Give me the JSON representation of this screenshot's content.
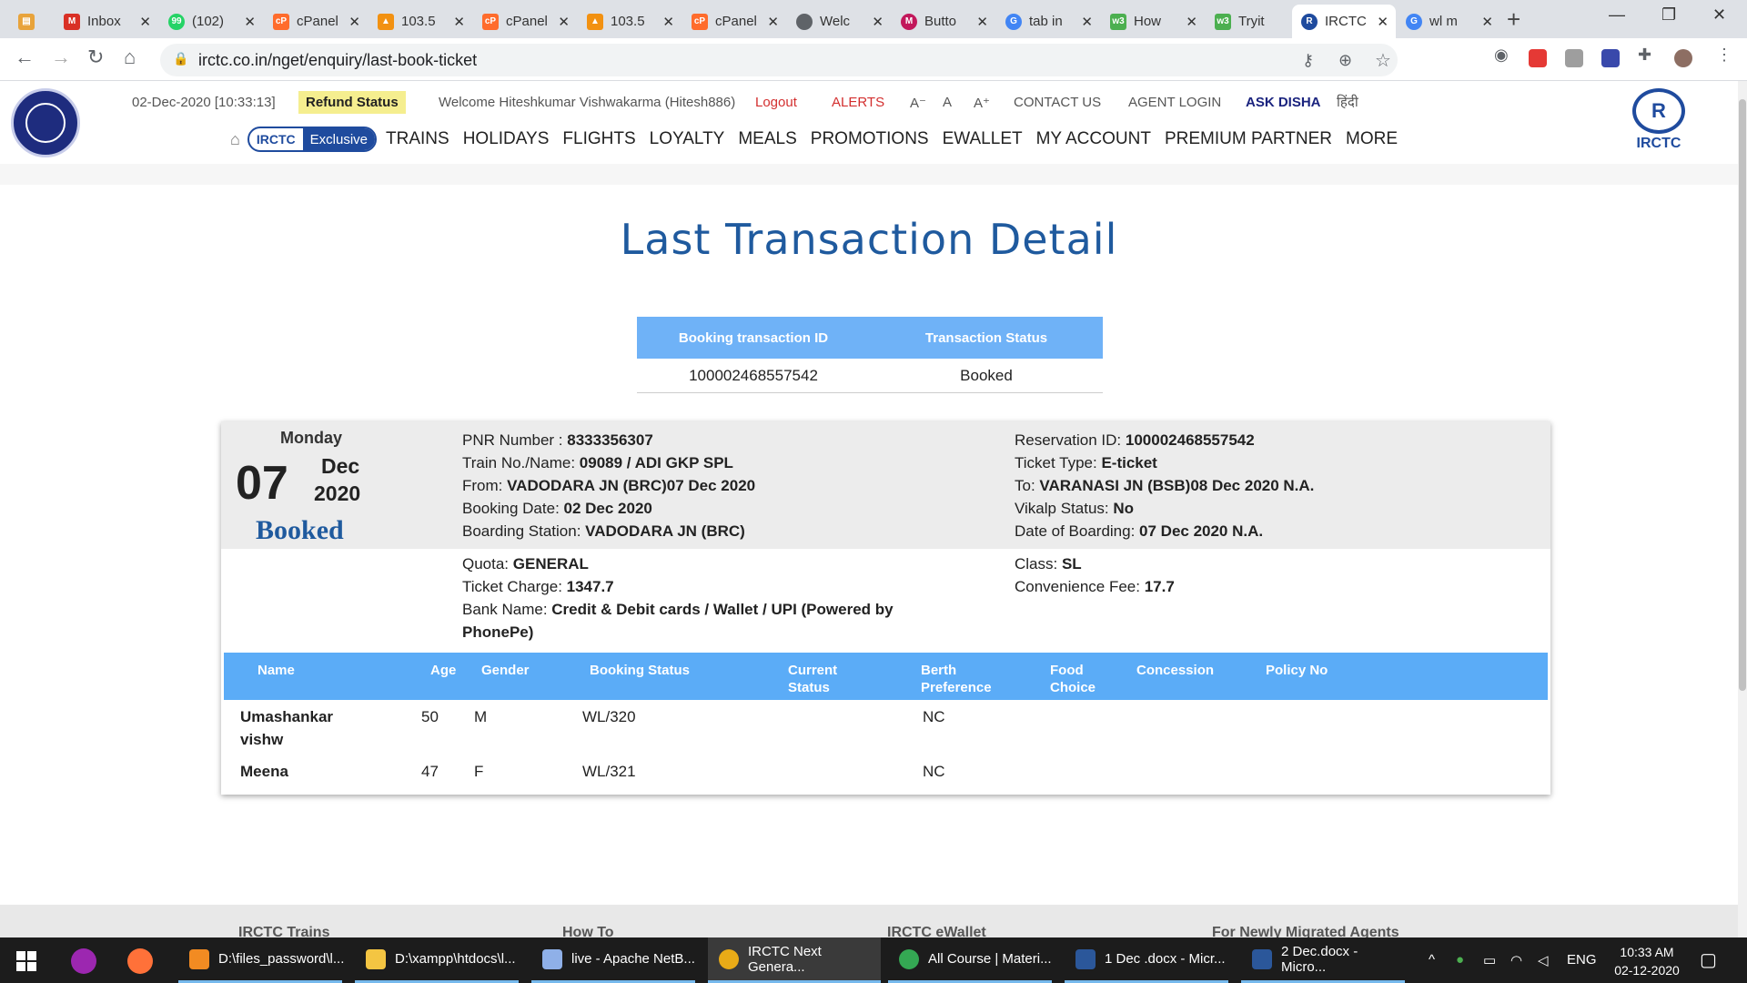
{
  "browser": {
    "tabs": [
      {
        "title": "",
        "color": "#e8a33b",
        "active": false
      },
      {
        "title": "Inbox",
        "color": "#d93025",
        "active": false
      },
      {
        "title": "(102)",
        "color": "#25d366",
        "active": false
      },
      {
        "title": "cPanel",
        "color": "#ff6c2c",
        "active": false
      },
      {
        "title": "103.5",
        "color": "#f29111",
        "active": false
      },
      {
        "title": "cPanel",
        "color": "#ff6c2c",
        "active": false
      },
      {
        "title": "103.5",
        "color": "#f29111",
        "active": false
      },
      {
        "title": "cPanel",
        "color": "#ff6c2c",
        "active": false
      },
      {
        "title": "Welc",
        "color": "#5f6368",
        "active": false
      },
      {
        "title": "Butto",
        "color": "#c2185b",
        "active": false
      },
      {
        "title": "tab in",
        "color": "#4285f4",
        "active": false
      },
      {
        "title": "How",
        "color": "#4caf50",
        "active": false
      },
      {
        "title": "Tryit",
        "color": "#4caf50",
        "active": false
      },
      {
        "title": "IRCTC",
        "color": "#1f4b9e",
        "active": true
      },
      {
        "title": "wl m",
        "color": "#4285f4",
        "active": false
      }
    ],
    "url": "irctc.co.in/nget/enquiry/last-book-ticket"
  },
  "header": {
    "datetime": "02-Dec-2020 [10:33:13]",
    "refund_label": "Refund Status",
    "welcome": "Welcome Hiteshkumar Vishwakarma (Hitesh886)",
    "logout": "Logout",
    "alerts": "ALERTS",
    "font_small": "A⁻",
    "font_normal": "A",
    "font_large": "A⁺",
    "contact": "CONTACT US",
    "agent_login": "AGENT LOGIN",
    "ask_disha": "ASK DISHA",
    "hindi": "हिंदी",
    "exclusive_a": "IRCTC",
    "exclusive_b": "Exclusive",
    "nav": [
      "TRAINS",
      "HOLIDAYS",
      "FLIGHTS",
      "LOYALTY",
      "MEALS",
      "PROMOTIONS",
      "EWALLET",
      "MY ACCOUNT",
      "PREMIUM PARTNER",
      "MORE"
    ],
    "brand_label": "IRCTC"
  },
  "page": {
    "title": "Last Transaction Detail"
  },
  "transaction": {
    "headers": [
      "Booking transaction ID",
      "Transaction Status"
    ],
    "id": "100002468557542",
    "status": "Booked"
  },
  "ticket": {
    "day_name": "Monday",
    "day": "07",
    "month": "Dec",
    "year": "2020",
    "booking_status": "Booked",
    "pnr_label": "PNR Number : ",
    "pnr": "8333356307",
    "train_label": "Train No./Name: ",
    "train": "09089 / ADI GKP SPL",
    "from_label": "From: ",
    "from": "VADODARA JN (BRC)07 Dec 2020",
    "booking_date_label": "Booking Date: ",
    "booking_date": "02 Dec 2020",
    "boarding_label": "Boarding Station: ",
    "boarding": "VADODARA JN (BRC)",
    "reservation_label": "Reservation ID: ",
    "reservation": "100002468557542",
    "ticket_type_label": "Ticket Type: ",
    "ticket_type": "E-ticket",
    "to_label": "To: ",
    "to": "VARANASI JN (BSB)08 Dec 2020 N.A.",
    "vikalp_label": "Vikalp Status: ",
    "vikalp": "No",
    "doj_label": "Date of Boarding: ",
    "doj": "07 Dec 2020 N.A.",
    "quota_label": "Quota: ",
    "quota": "GENERAL",
    "charge_label": "Ticket Charge: ",
    "charge": "1347.7",
    "bank_label": "Bank Name: ",
    "bank_line1": "Credit & Debit cards / Wallet / UPI (Powered by",
    "bank_line2": "PhonePe)",
    "class_label": "Class: ",
    "class": "SL",
    "fee_label": "Convenience Fee: ",
    "fee": "17.7"
  },
  "passengers": {
    "headers": {
      "name": "Name",
      "age": "Age",
      "gender": "Gender",
      "booking_status": "Booking Status",
      "current_1": "Current",
      "current_2": "Status",
      "berth_1": "Berth",
      "berth_2": "Preference",
      "food_1": "Food",
      "food_2": "Choice",
      "concession": "Concession",
      "policy": "Policy No"
    },
    "rows": [
      {
        "name_1": "Umashankar",
        "name_2": "vishw",
        "age": "50",
        "gender": "M",
        "status": "WL/320",
        "berth": "NC"
      },
      {
        "name_1": "Meena",
        "name_2": "",
        "age": "47",
        "gender": "F",
        "status": "WL/321",
        "berth": "NC"
      }
    ]
  },
  "footer": [
    "IRCTC Trains",
    "How To",
    "IRCTC eWallet",
    "For Newly Migrated Agents"
  ],
  "taskbar": {
    "items": [
      {
        "label": "D:\\files_password\\l...",
        "color": "#f28b22"
      },
      {
        "label": "D:\\xampp\\htdocs\\l...",
        "color": "#f4c542"
      },
      {
        "label": "live - Apache NetB...",
        "color": "#8fb0e8"
      },
      {
        "label": "IRCTC Next Genera...",
        "color": "#e9ab17"
      },
      {
        "label": "All Course | Materi...",
        "color": "#34a853"
      },
      {
        "label": "1 Dec .docx - Micr...",
        "color": "#2b579a"
      },
      {
        "label": "2 Dec.docx - Micro...",
        "color": "#2b579a"
      }
    ],
    "lang": "ENG",
    "time": "10:33 AM",
    "date": "02-12-2020"
  }
}
